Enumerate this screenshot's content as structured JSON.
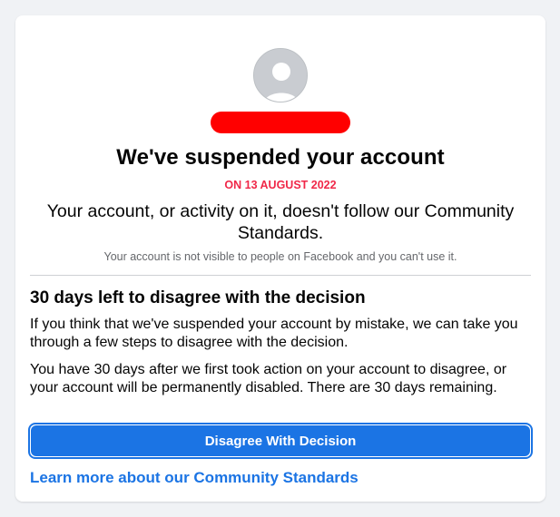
{
  "suspension": {
    "title": "We've suspended your account",
    "date": "ON 13 AUGUST 2022",
    "lead": "Your account, or activity on it, doesn't follow our Community Standards.",
    "note": "Your account is not visible to people on Facebook and you can't use it."
  },
  "decision": {
    "heading": "30 days left to disagree with the decision",
    "paragraph_1": "If you think that we've suspended your account by mistake, we can take you through a few steps to disagree with the decision.",
    "paragraph_2": "You have 30 days after we first took action on your account to disagree, or your account will be permanently disabled. There are 30 days remaining.",
    "button_label": "Disagree With Decision",
    "link_label": "Learn more about our Community Standards"
  },
  "icons": {
    "avatar": "default-profile-avatar-icon"
  },
  "colors": {
    "page_background": "#f0f2f5",
    "accent": "#1b74e4",
    "date_red": "#f02849",
    "redaction": "#ff0000"
  }
}
